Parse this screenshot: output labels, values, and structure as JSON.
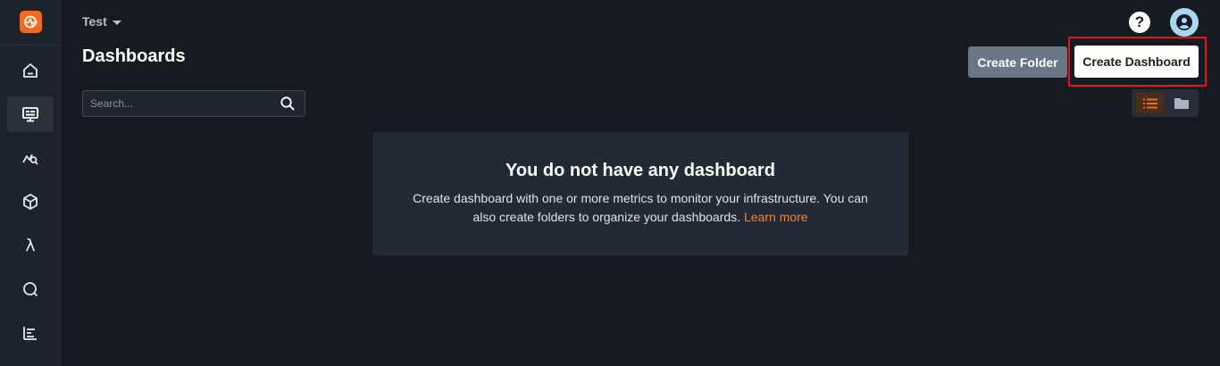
{
  "header": {
    "environment": "Test",
    "page_title": "Dashboards"
  },
  "actions": {
    "create_folder": "Create Folder",
    "create_dashboard": "Create Dashboard"
  },
  "search": {
    "placeholder": "Search..."
  },
  "empty_state": {
    "title": "You do not have any dashboard",
    "description": "Create dashboard with one or more metrics to monitor your infrastructure. You can also create folders to organize your dashboards.",
    "link": "Learn more"
  },
  "header_icons": {
    "help": "?"
  },
  "sidebar": {
    "lambda_glyph": "λ",
    "items": [
      "home-icon",
      "dashboard-icon",
      "metrics-explorer-icon",
      "package-icon",
      "lambda-icon",
      "search-icon",
      "reports-icon"
    ]
  },
  "colors": {
    "accent": "#f26b21",
    "link": "#f2802e",
    "background": "#161b22",
    "sidebar": "#1c232d",
    "card": "#222a35",
    "highlight": "#e0141b"
  }
}
